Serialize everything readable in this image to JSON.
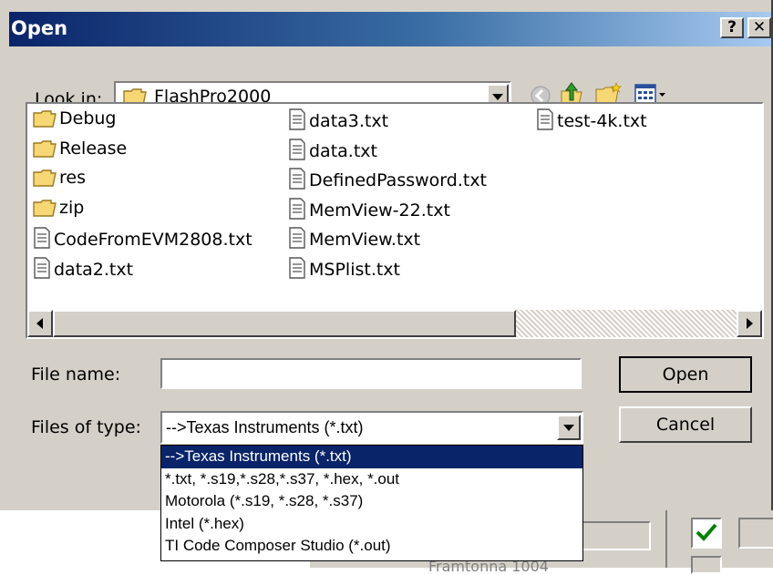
{
  "dialog": {
    "title": "Open",
    "help_label": "?",
    "close_label": "✕"
  },
  "look_in": {
    "label": "Look in:",
    "folder": "FlashPro2000"
  },
  "files": [
    {
      "name": "Debug",
      "icon": "folder-icon"
    },
    {
      "name": "Release",
      "icon": "folder-icon"
    },
    {
      "name": "res",
      "icon": "folder-icon"
    },
    {
      "name": "zip",
      "icon": "folder-icon"
    },
    {
      "name": "CodeFromEVM2808.txt",
      "icon": "text-file-icon"
    },
    {
      "name": "data2.txt",
      "icon": "text-file-icon"
    },
    {
      "name": "data3.txt",
      "icon": "text-file-icon"
    },
    {
      "name": "data.txt",
      "icon": "text-file-icon"
    },
    {
      "name": "DefinedPassword.txt",
      "icon": "text-file-icon"
    },
    {
      "name": "MemView-22.txt",
      "icon": "text-file-icon"
    },
    {
      "name": "MemView.txt",
      "icon": "text-file-icon"
    },
    {
      "name": "MSPlist.txt",
      "icon": "text-file-icon"
    },
    {
      "name": "test-4k.txt",
      "icon": "text-file-icon"
    }
  ],
  "file_name": {
    "label": "File name:",
    "value": ""
  },
  "files_of_type": {
    "label": "Files of type:",
    "selected": "-->Texas Instruments (*.txt)",
    "options": [
      "-->Texas Instruments (*.txt)",
      "*.txt, *.s19,*.s28,*.s37, *.hex, *.out",
      "Motorola  (*.s19, *.s28, *.s37)",
      "Intel  (*.hex)",
      "TI Code Composer Studio (*.out)"
    ]
  },
  "buttons": {
    "open": "Open",
    "cancel": "Cancel"
  },
  "background": {
    "partial_text": "Framtonna 1004"
  },
  "colors": {
    "title_start": "#0a246a",
    "title_end": "#a6caf0",
    "face": "#d4d0c8",
    "selection": "#0a246a",
    "checkmark": "#008000"
  }
}
